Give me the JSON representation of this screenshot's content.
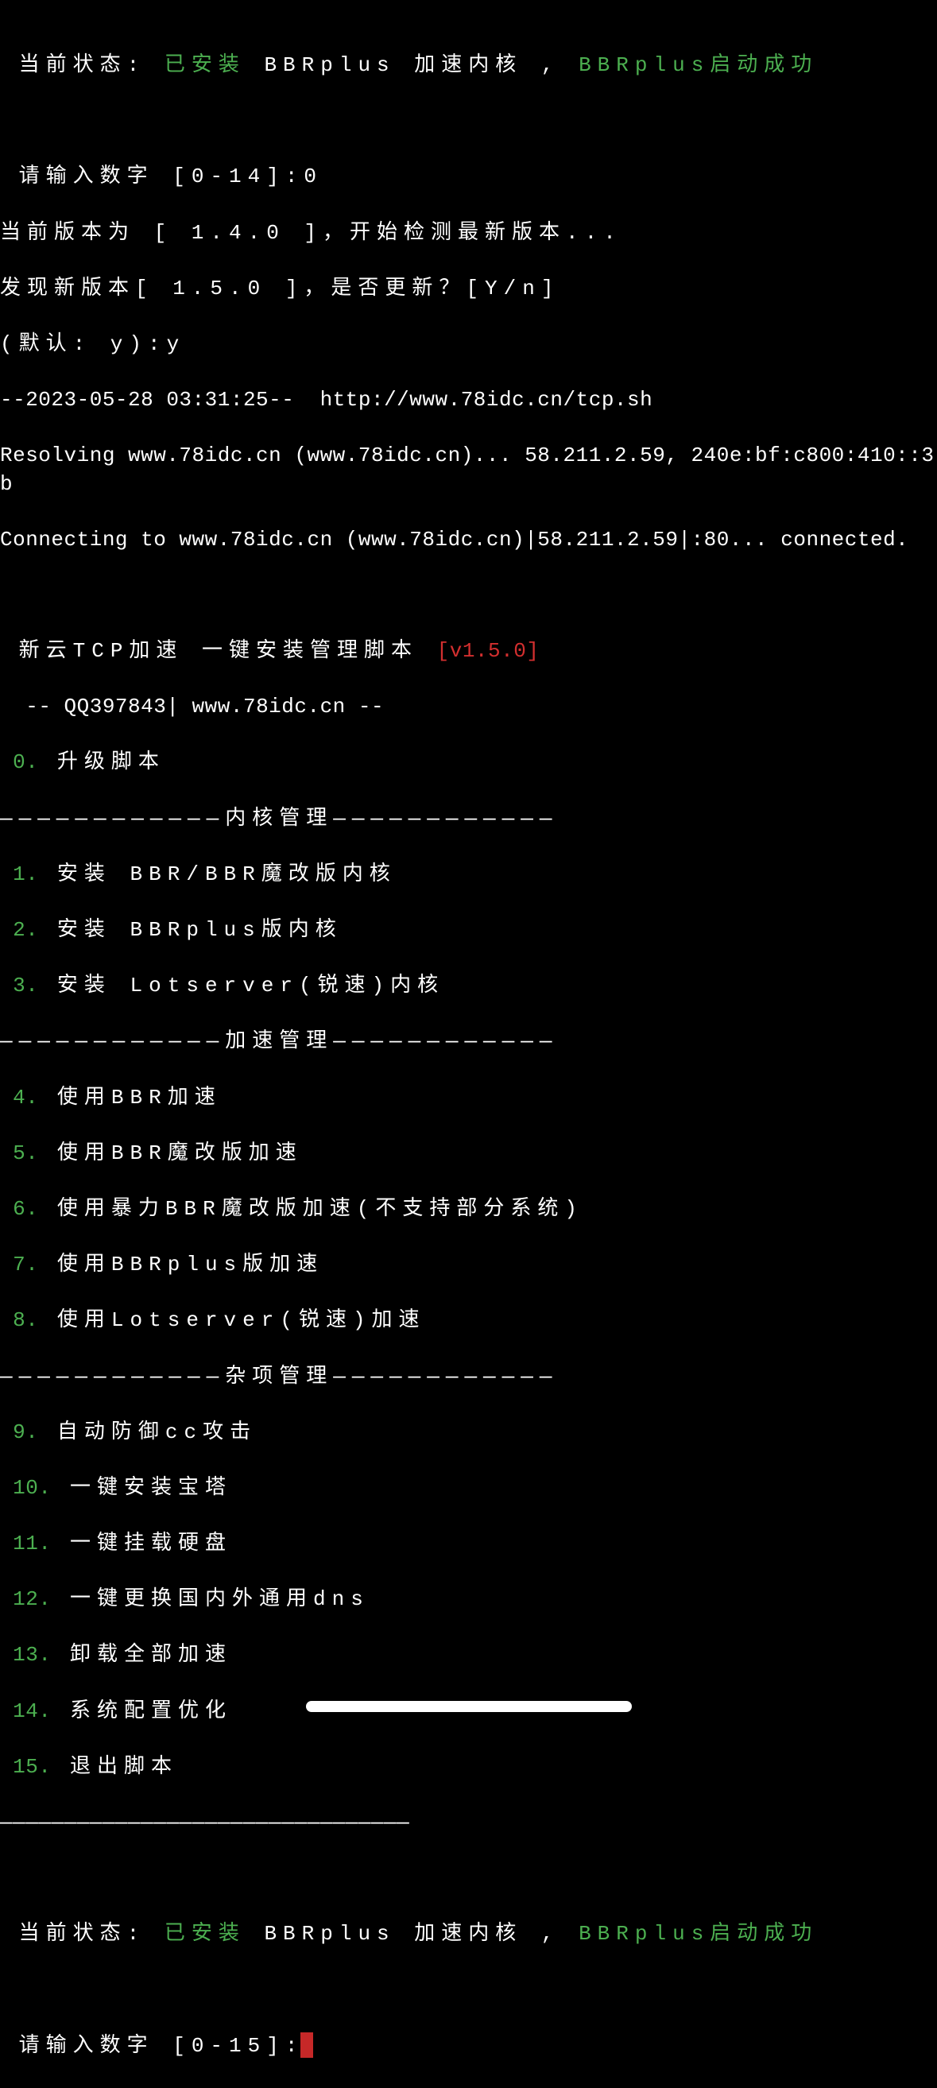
{
  "status1": {
    "label": " 当前状态: ",
    "installed": "已安装",
    "kernel": " BBRplus 加速内核 , ",
    "success": "BBRplus启动成功"
  },
  "prompt1": " 请输入数字 [0-14]:0",
  "version_check": "当前版本为 [ 1.4.0 ]，开始检测最新版本...",
  "new_version": "发现新版本[ 1.5.0 ]，是否更新？[Y/n]",
  "default_prompt": "(默认: y):y",
  "wget_time": "--2023-05-28 03:31:25--  http://www.78idc.cn/tcp.sh",
  "resolving": "Resolving www.78idc.cn (www.78idc.cn)... 58.211.2.59, 240e:bf:c800:410::3b",
  "connecting": "Connecting to www.78idc.cn (www.78idc.cn)|58.211.2.59|:80... connected.",
  "script_title": " 新云TCP加速 一键安装管理脚本 ",
  "script_version": "[v1.5.0]",
  "script_credit": "  -- QQ397843| www.78idc.cn --",
  "menu": {
    "item0": {
      "num": " 0.",
      "text": " 升级脚本"
    },
    "section1": "————————————内核管理————————————",
    "item1": {
      "num": " 1.",
      "text": " 安装 BBR/BBR魔改版内核"
    },
    "item2": {
      "num": " 2.",
      "text": " 安装 BBRplus版内核"
    },
    "item3": {
      "num": " 3.",
      "text": " 安装 Lotserver(锐速)内核"
    },
    "section2": "————————————加速管理————————————",
    "item4": {
      "num": " 4.",
      "text": " 使用BBR加速"
    },
    "item5": {
      "num": " 5.",
      "text": " 使用BBR魔改版加速"
    },
    "item6": {
      "num": " 6.",
      "text": " 使用暴力BBR魔改版加速(不支持部分系统)"
    },
    "item7": {
      "num": " 7.",
      "text": " 使用BBRplus版加速"
    },
    "item8": {
      "num": " 8.",
      "text": " 使用Lotserver(锐速)加速"
    },
    "section3": "————————————杂项管理————————————",
    "item9": {
      "num": " 9.",
      "text": " 自动防御cc攻击"
    },
    "item10": {
      "num": " 10.",
      "text": " 一键安装宝塔"
    },
    "item11": {
      "num": " 11.",
      "text": " 一键挂载硬盘"
    },
    "item12": {
      "num": " 12.",
      "text": " 一键更换国内外通用dns"
    },
    "item13": {
      "num": " 13.",
      "text": " 卸载全部加速"
    },
    "item14": {
      "num": " 14.",
      "text": " 系统配置优化"
    },
    "item15": {
      "num": " 15.",
      "text": " 退出脚本"
    },
    "separator": "————————————————————————————————"
  },
  "status2": {
    "label": " 当前状态: ",
    "installed": "已安装",
    "kernel": " BBRplus 加速内核 , ",
    "success": "BBRplus启动成功"
  },
  "prompt2": " 请输入数字 [0-15]:"
}
